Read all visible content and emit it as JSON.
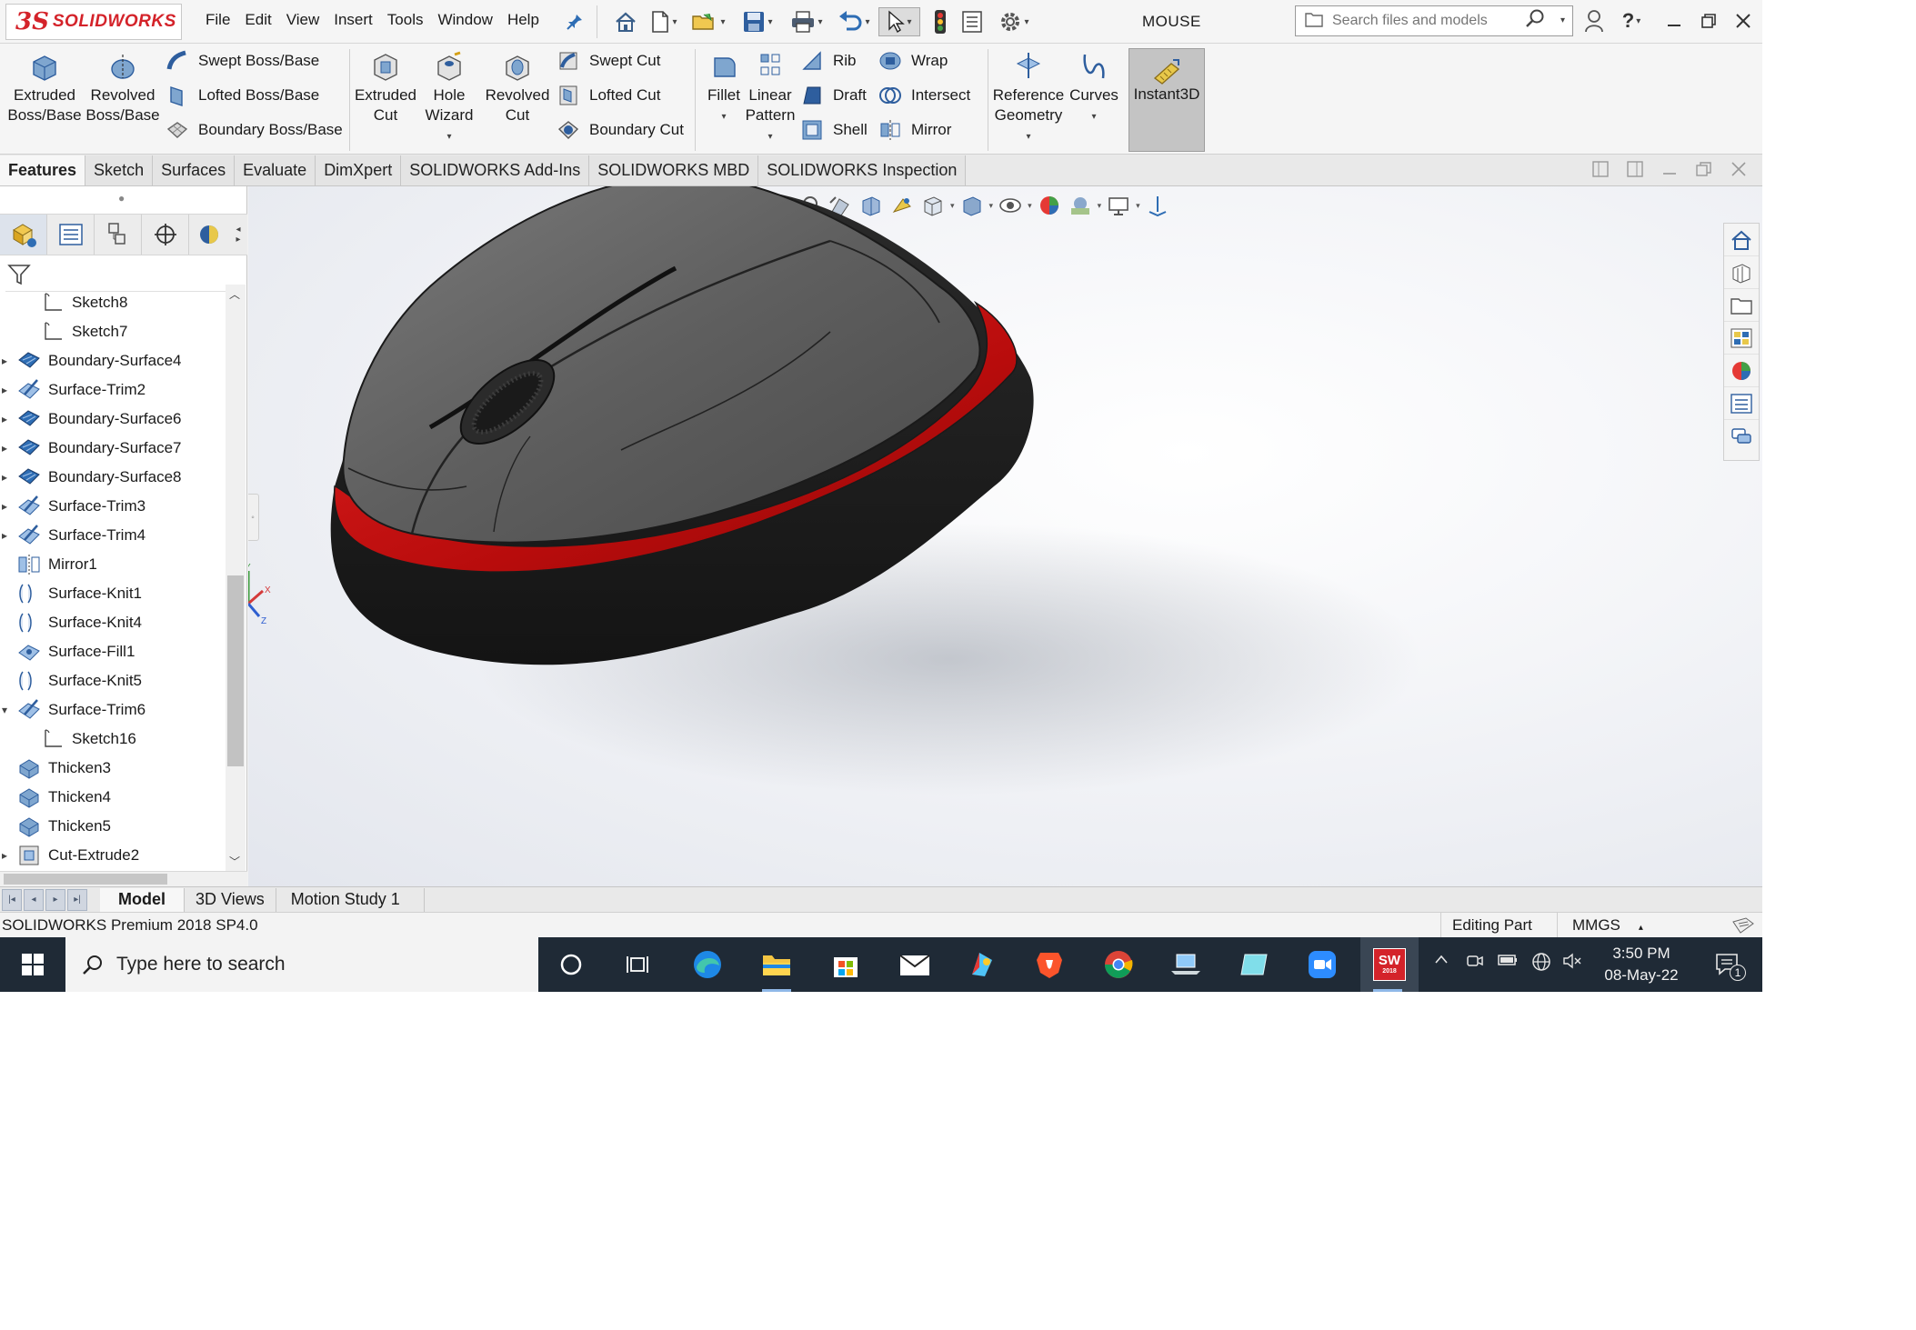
{
  "app": {
    "logo_ds": "3S",
    "logo_text": "SOLIDWORKS",
    "document_title": "MOUSE",
    "menu": [
      "File",
      "Edit",
      "View",
      "Insert",
      "Tools",
      "Window",
      "Help"
    ],
    "search_placeholder": "Search files and models"
  },
  "command_manager": {
    "extruded_boss": "Extruded\nBoss/Base",
    "revolved_boss": "Revolved\nBoss/Base",
    "swept_boss": "Swept Boss/Base",
    "lofted_boss": "Lofted Boss/Base",
    "boundary_boss": "Boundary Boss/Base",
    "extruded_cut": "Extruded\nCut",
    "hole_wizard": "Hole\nWizard",
    "revolved_cut": "Revolved\nCut",
    "swept_cut": "Swept Cut",
    "lofted_cut": "Lofted Cut",
    "boundary_cut": "Boundary Cut",
    "fillet": "Fillet",
    "linear_pattern": "Linear\nPattern",
    "rib": "Rib",
    "draft": "Draft",
    "shell": "Shell",
    "wrap": "Wrap",
    "intersect": "Intersect",
    "mirror": "Mirror",
    "reference_geometry": "Reference\nGeometry",
    "curves": "Curves",
    "instant3d": "Instant3D"
  },
  "tabs": [
    "Features",
    "Sketch",
    "Surfaces",
    "Evaluate",
    "DimXpert",
    "SOLIDWORKS Add-Ins",
    "SOLIDWORKS MBD",
    "SOLIDWORKS Inspection"
  ],
  "active_tab": "Features",
  "feature_tree": [
    {
      "label": "Sketch8",
      "icon": "sketch-icon",
      "indent": 1,
      "expander": ""
    },
    {
      "label": "Sketch7",
      "icon": "sketch-icon",
      "indent": 1,
      "expander": ""
    },
    {
      "label": "Boundary-Surface4",
      "icon": "boundary-surface-icon",
      "indent": 0,
      "expander": "collapsed"
    },
    {
      "label": "Surface-Trim2",
      "icon": "surface-trim-icon",
      "indent": 0,
      "expander": "collapsed"
    },
    {
      "label": "Boundary-Surface6",
      "icon": "boundary-surface-icon",
      "indent": 0,
      "expander": "collapsed"
    },
    {
      "label": "Boundary-Surface7",
      "icon": "boundary-surface-icon",
      "indent": 0,
      "expander": "collapsed"
    },
    {
      "label": "Boundary-Surface8",
      "icon": "boundary-surface-icon",
      "indent": 0,
      "expander": "collapsed"
    },
    {
      "label": "Surface-Trim3",
      "icon": "surface-trim-icon",
      "indent": 0,
      "expander": "collapsed"
    },
    {
      "label": "Surface-Trim4",
      "icon": "surface-trim-icon",
      "indent": 0,
      "expander": "collapsed"
    },
    {
      "label": "Mirror1",
      "icon": "mirror-icon",
      "indent": 0,
      "expander": ""
    },
    {
      "label": "Surface-Knit1",
      "icon": "surface-knit-icon",
      "indent": 0,
      "expander": ""
    },
    {
      "label": "Surface-Knit4",
      "icon": "surface-knit-icon",
      "indent": 0,
      "expander": ""
    },
    {
      "label": "Surface-Fill1",
      "icon": "surface-fill-icon",
      "indent": 0,
      "expander": ""
    },
    {
      "label": "Surface-Knit5",
      "icon": "surface-knit-icon",
      "indent": 0,
      "expander": ""
    },
    {
      "label": "Surface-Trim6",
      "icon": "surface-trim-icon",
      "indent": 0,
      "expander": "expanded"
    },
    {
      "label": "Sketch16",
      "icon": "sketch-icon",
      "indent": 1,
      "expander": ""
    },
    {
      "label": "Thicken3",
      "icon": "thicken-icon",
      "indent": 0,
      "expander": ""
    },
    {
      "label": "Thicken4",
      "icon": "thicken-icon",
      "indent": 0,
      "expander": ""
    },
    {
      "label": "Thicken5",
      "icon": "thicken-icon",
      "indent": 0,
      "expander": ""
    },
    {
      "label": "Cut-Extrude2",
      "icon": "cut-extrude-icon",
      "indent": 0,
      "expander": "collapsed"
    }
  ],
  "triad": {
    "x": "X",
    "y": "Y",
    "z": "Z"
  },
  "bottom_tabs": [
    "Model",
    "3D Views",
    "Motion Study 1"
  ],
  "active_bottom_tab": "Model",
  "status": {
    "product": "SOLIDWORKS Premium 2018 SP4.0",
    "mode": "Editing Part",
    "units": "MMGS"
  },
  "taskbar": {
    "search_placeholder": "Type here to search",
    "time": "3:50 PM",
    "date": "08-May-22",
    "notification_count": "1",
    "solidworks_badge": "SW",
    "solidworks_version": "2018"
  },
  "colors": {
    "brand_red": "#d4232a",
    "mouse_red": "#c0100f",
    "mouse_grey": "#5a5a5a",
    "mouse_black": "#1e1e1e",
    "taskbar": "#1f2a36"
  }
}
